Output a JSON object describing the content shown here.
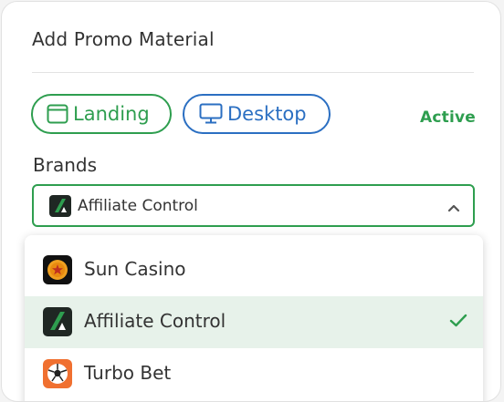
{
  "panel": {
    "title": "Add Promo Material"
  },
  "tags": [
    {
      "label": "Landing",
      "icon": "browser-window-icon",
      "color": "#2e9e4f"
    },
    {
      "label": "Desktop",
      "icon": "monitor-icon",
      "color": "#2b6fc2"
    }
  ],
  "status": {
    "label": "Active",
    "color": "#2e9e4f"
  },
  "brands": {
    "label": "Brands",
    "selected_value": "Affiliate Control",
    "selected_icon": "affiliate-control-logo",
    "expand_icon": "chevron-up-icon",
    "options": [
      {
        "label": "Sun Casino",
        "icon": "sun-casino-logo",
        "selected": false
      },
      {
        "label": "Affiliate Control",
        "icon": "affiliate-control-logo",
        "selected": true,
        "indicator": "check-icon"
      },
      {
        "label": "Turbo Bet",
        "icon": "turbo-bet-logo",
        "selected": false
      }
    ]
  },
  "colors": {
    "accent_green": "#2e9e4f",
    "accent_blue": "#2b6fc2",
    "selected_row_bg": "#e7f2ea"
  }
}
